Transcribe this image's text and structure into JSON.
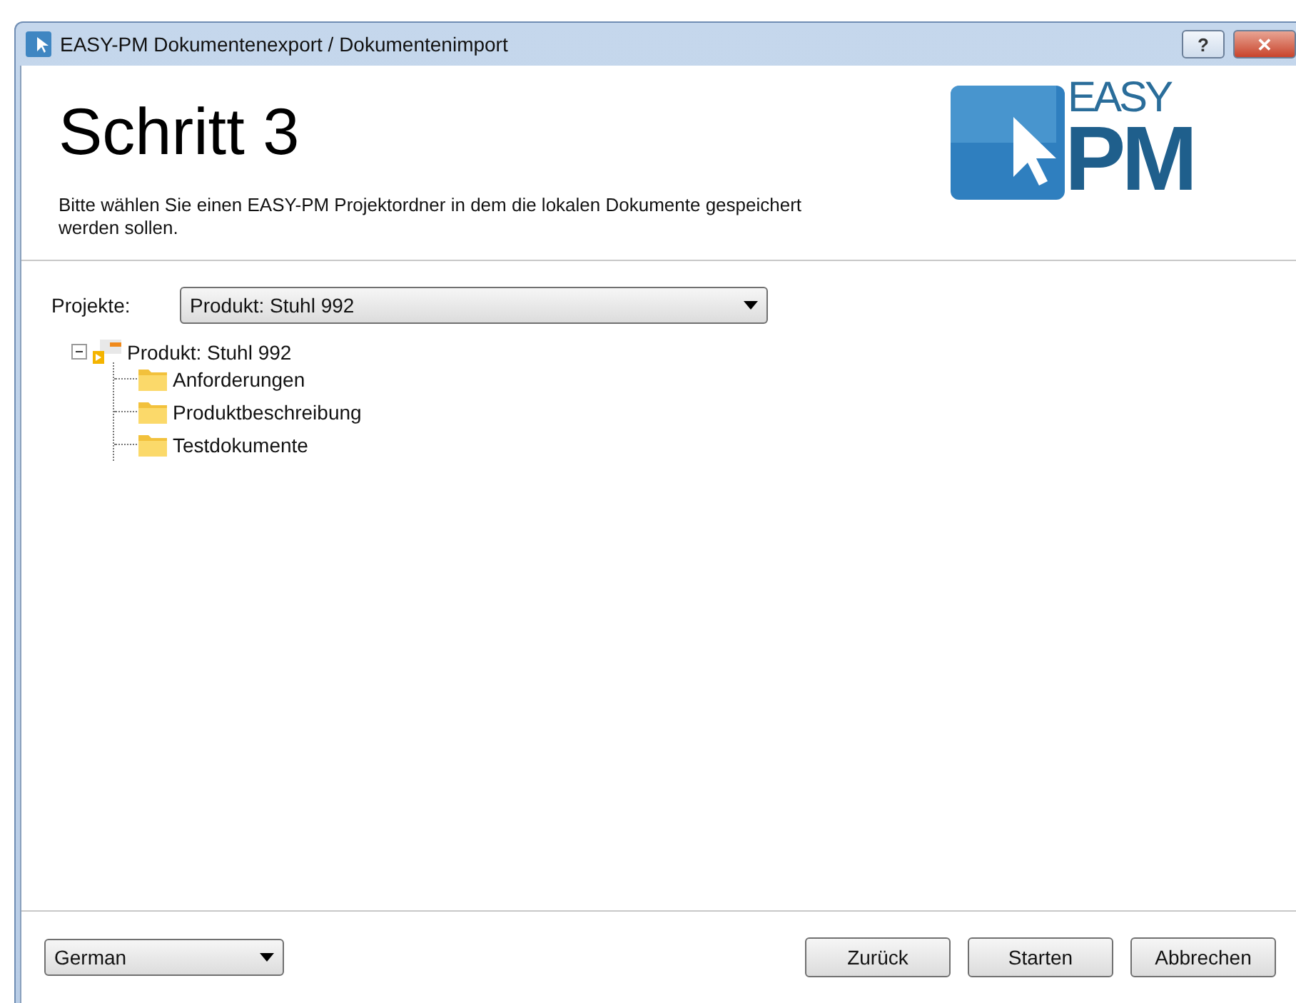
{
  "window": {
    "title": "EASY-PM Dokumentenexport / Dokumentenimport",
    "help_button": "?",
    "close_button": "✕"
  },
  "header": {
    "title": "Schritt 3",
    "description": "Bitte wählen Sie einen EASY-PM Projektordner in dem die lokalen Dokumente gespeichert werden sollen.",
    "logo": {
      "top": "EASY",
      "bottom": "PM"
    }
  },
  "project_picker": {
    "label": "Projekte:",
    "value": "Produkt: Stuhl 992"
  },
  "tree": [
    {
      "label": "Produkt: Stuhl 992",
      "kind": "project",
      "expanded": true,
      "children": [
        {
          "label": "Anforderungen",
          "kind": "folder"
        },
        {
          "label": "Produktbeschreibung",
          "kind": "folder"
        },
        {
          "label": "Testdokumente",
          "kind": "folder"
        }
      ]
    }
  ],
  "language": {
    "value": "German"
  },
  "buttons": [
    "Zurück",
    "Starten",
    "Abbrechen"
  ]
}
